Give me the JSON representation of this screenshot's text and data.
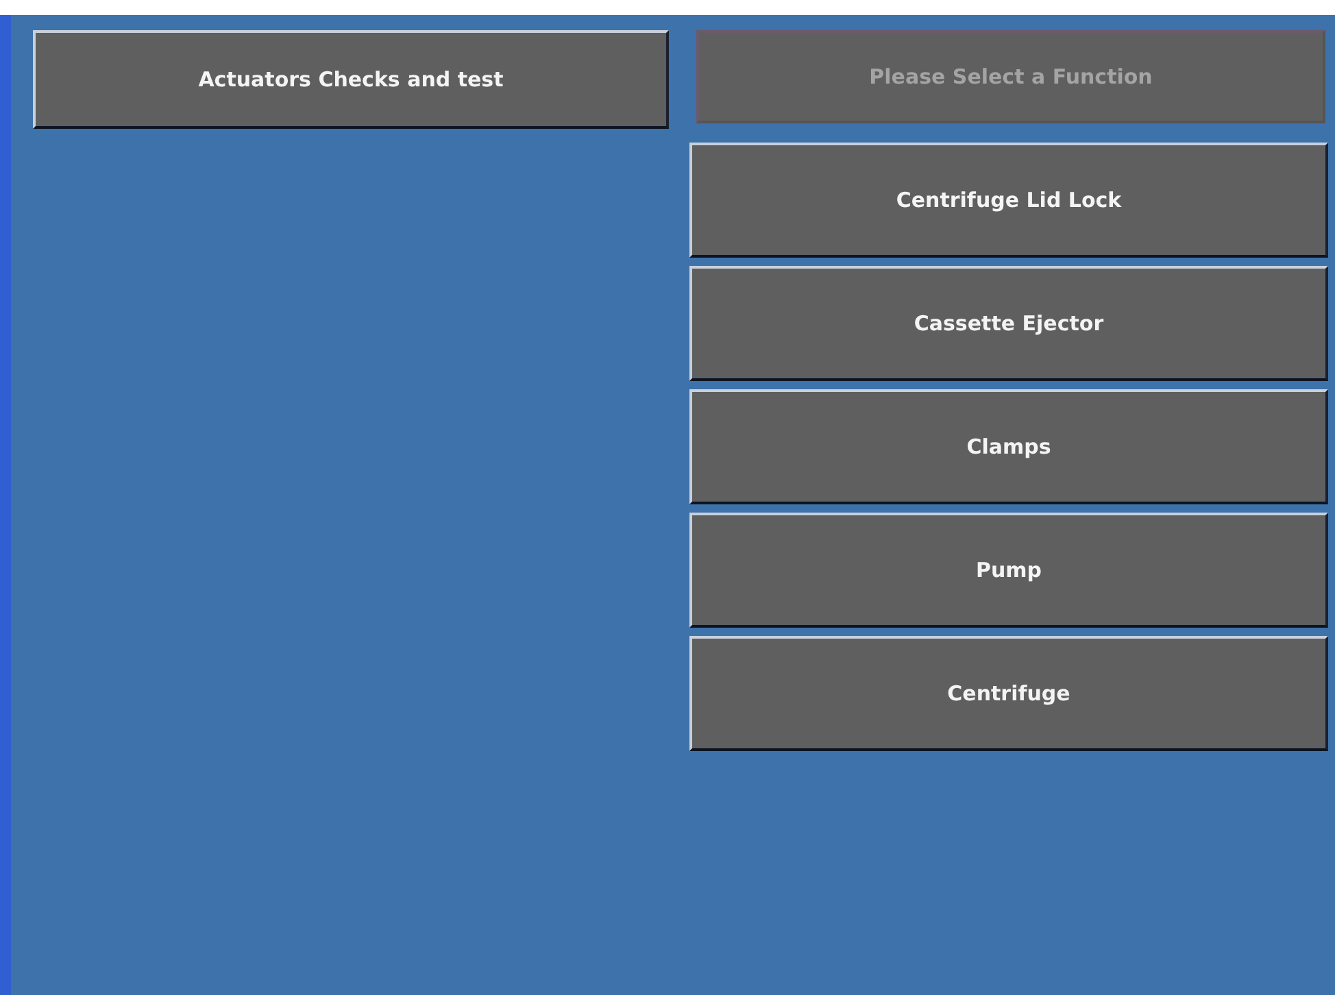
{
  "menu_button": {
    "label": "Actuators Checks and test"
  },
  "function_header": {
    "label": "Please Select a Function",
    "disabled": true
  },
  "functions": [
    {
      "label": "Centrifuge Lid Lock"
    },
    {
      "label": "Cassette Ejector"
    },
    {
      "label": "Clamps"
    },
    {
      "label": "Pump"
    },
    {
      "label": "Centrifuge"
    }
  ]
}
